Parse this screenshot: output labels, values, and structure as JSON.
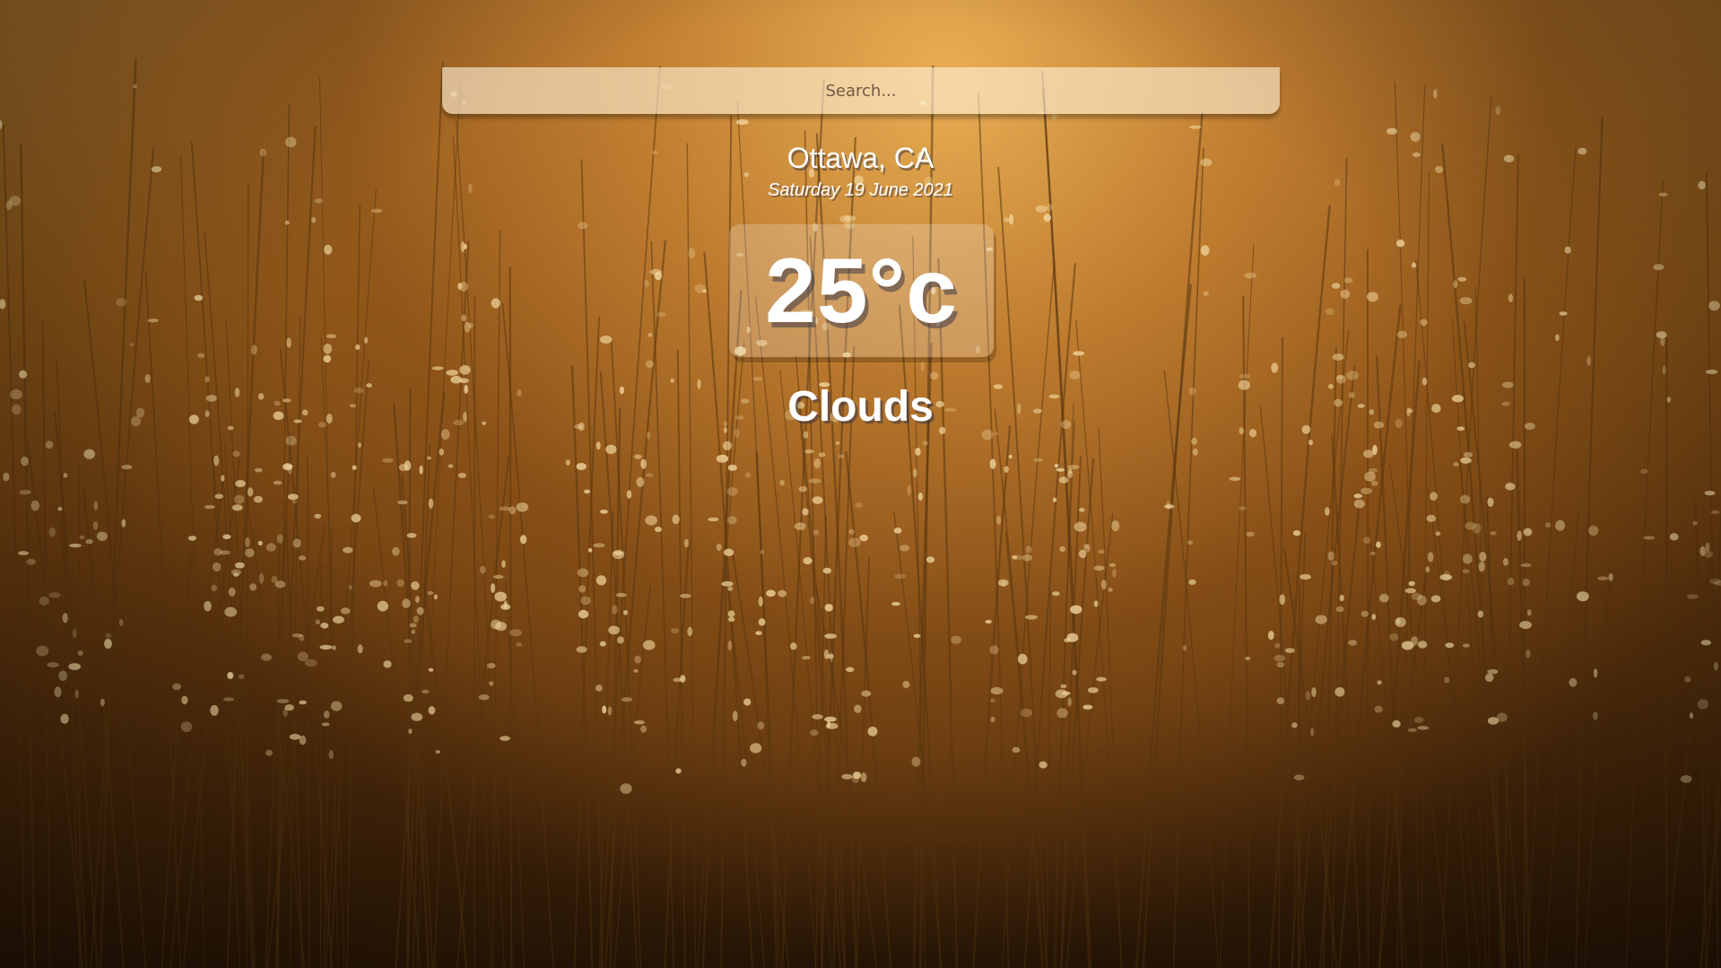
{
  "search": {
    "placeholder": "Search...",
    "value": ""
  },
  "location": {
    "city": "Ottawa, CA",
    "date": "Saturday 19 June 2021"
  },
  "weather": {
    "temperature": "25°c",
    "condition": "Clouds"
  },
  "colors": {
    "background_warm": "#a5702c",
    "background_dark": "#2e1906",
    "text": "#ffffff"
  }
}
